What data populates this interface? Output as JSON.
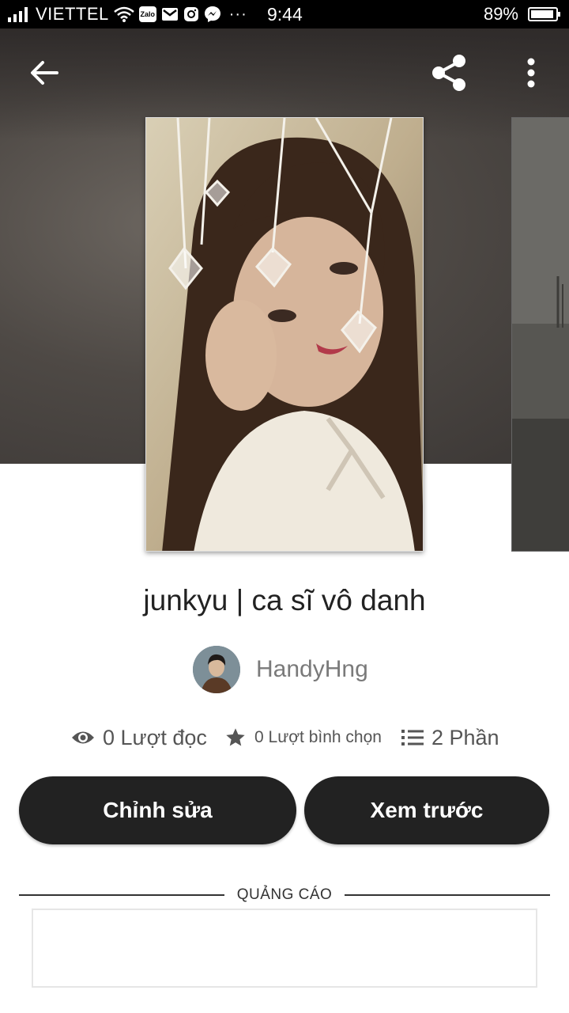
{
  "status_bar": {
    "carrier": "VIETTEL",
    "time": "9:44",
    "battery": "89%",
    "battery_level": 0.89,
    "notification_icons": [
      "wifi-icon",
      "zalo-icon",
      "gmail-icon",
      "instagram-icon",
      "messenger-icon",
      "more-notifications-icon"
    ],
    "zalo_label": "Zalo",
    "more_notifications": "···"
  },
  "story": {
    "title": "junkyu | ca sĩ vô danh",
    "author": "HandyHng",
    "stats": {
      "reads": "0 Lượt đọc",
      "votes": "0 Lượt bình chọn",
      "parts": "2 Phần"
    }
  },
  "actions": {
    "edit_label": "Chỉnh sửa",
    "preview_label": "Xem trước"
  },
  "ad": {
    "label": "QUẢNG CÁO"
  },
  "colors": {
    "button_bg": "#222222",
    "button_text": "#ffffff",
    "author_text": "#7a7a7a",
    "hero_bg": "#4e4945"
  }
}
